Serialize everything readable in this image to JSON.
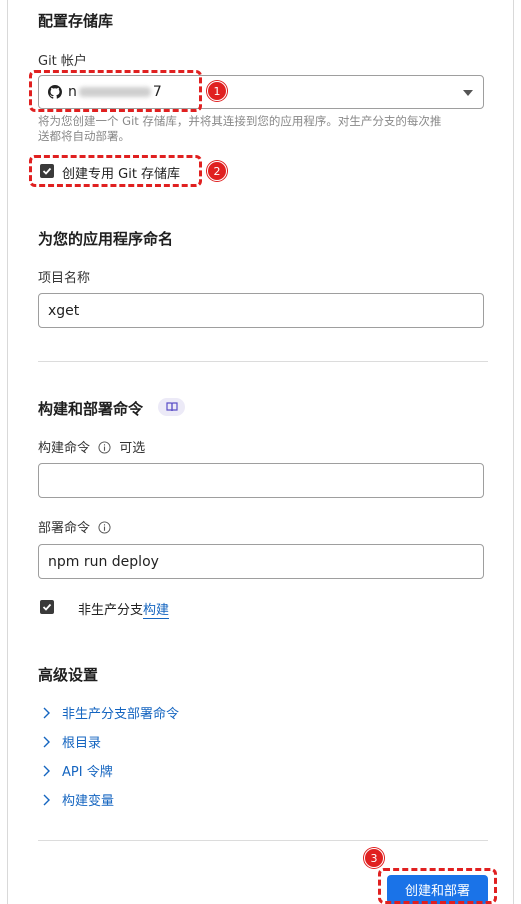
{
  "repo": {
    "title": "配置存储库",
    "account_label": "Git 帐户",
    "account_prefix": "n",
    "account_suffix": "7",
    "help_line1": "将为您创建一个 Git 存储库，并将其连接到您的应用程序。对生产分支的每次推",
    "help_line2": "送都将自动部署。",
    "create_repo_label": "创建专用 Git 存储库"
  },
  "naming": {
    "title": "为您的应用程序命名",
    "project_label": "项目名称",
    "project_value": "xget"
  },
  "build": {
    "title": "构建和部署命令",
    "build_label": "构建命令",
    "optional": "可选",
    "build_value": "",
    "deploy_label": "部署命令",
    "deploy_value": "npm run deploy",
    "nonprod_text": "非生产分支",
    "nonprod_link": "构建"
  },
  "advanced": {
    "title": "高级设置",
    "items": [
      "非生产分支部署命令",
      "根目录",
      "API 令牌",
      "构建变量"
    ]
  },
  "footer": {
    "submit_label": "创建和部署"
  },
  "annotations": [
    "1",
    "2",
    "3"
  ],
  "colors": {
    "accent": "#1a73e8",
    "link": "#1565c0",
    "annotation": "#e02020"
  }
}
